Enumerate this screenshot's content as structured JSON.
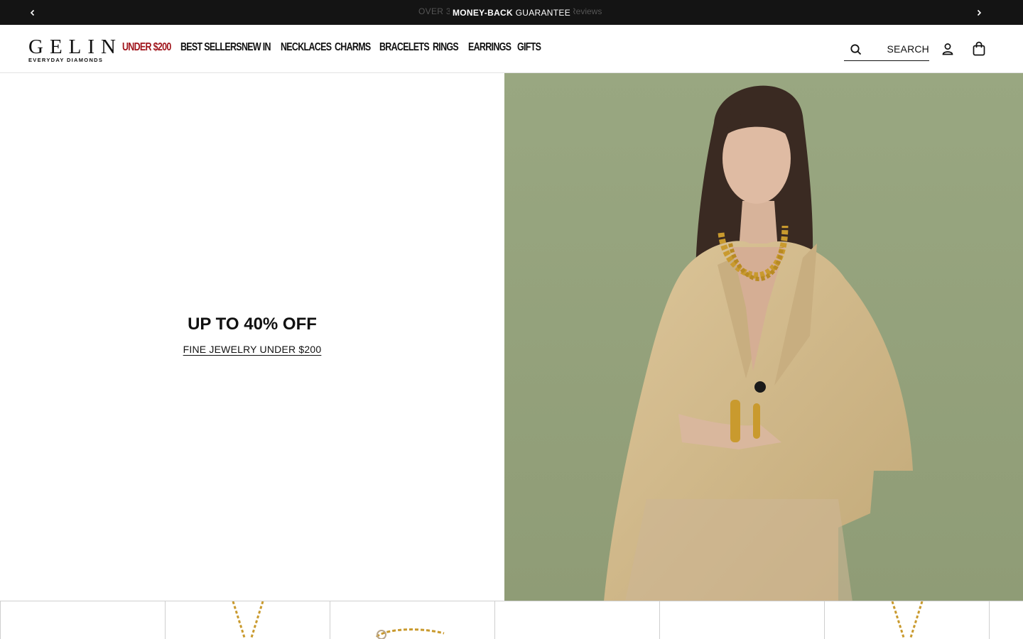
{
  "announcement": {
    "prev_icon": "chevron-left-icon",
    "next_icon": "chevron-right-icon",
    "ghost_left": "OVER 3",
    "ghost_right": "Reviews",
    "message_bold": "MONEY-BACK",
    "message_rest": "GUARANTEE"
  },
  "header": {
    "logo_word": "GELIN",
    "logo_tagline": "EVERYDAY DIAMONDS",
    "nav": [
      {
        "label": "UNDER $200",
        "highlight": true
      },
      {
        "label": "BEST SELLERS"
      },
      {
        "label": "NEW IN"
      },
      {
        "label": "NECKLACES"
      },
      {
        "label": "CHARMS"
      },
      {
        "label": "BRACELETS"
      },
      {
        "label": "RINGS"
      },
      {
        "label": "EARRINGS"
      },
      {
        "label": "GIFTS"
      }
    ],
    "search_label": "SEARCH",
    "icons": {
      "search": "search-icon",
      "account": "user-icon",
      "cart": "shopping-bag-icon"
    }
  },
  "hero": {
    "headline": "UP TO 40% OFF",
    "cta": "FINE JEWELRY UNDER $200",
    "image": "model-in-beige-blazer-gold-chain-necklace-bracelets",
    "bg_color": "#97a57f"
  },
  "colors": {
    "sale": "#a0151c",
    "topbar": "#141414",
    "gold": "#c99a2e"
  },
  "product_strip": {
    "tiles": [
      {
        "image": "blank"
      },
      {
        "image": "gold-chain-necklace"
      },
      {
        "image": "gold-chain-bracelet"
      },
      {
        "image": "blank"
      },
      {
        "image": "blank"
      },
      {
        "image": "gold-chain-necklace"
      },
      {
        "image": "blank"
      }
    ]
  }
}
